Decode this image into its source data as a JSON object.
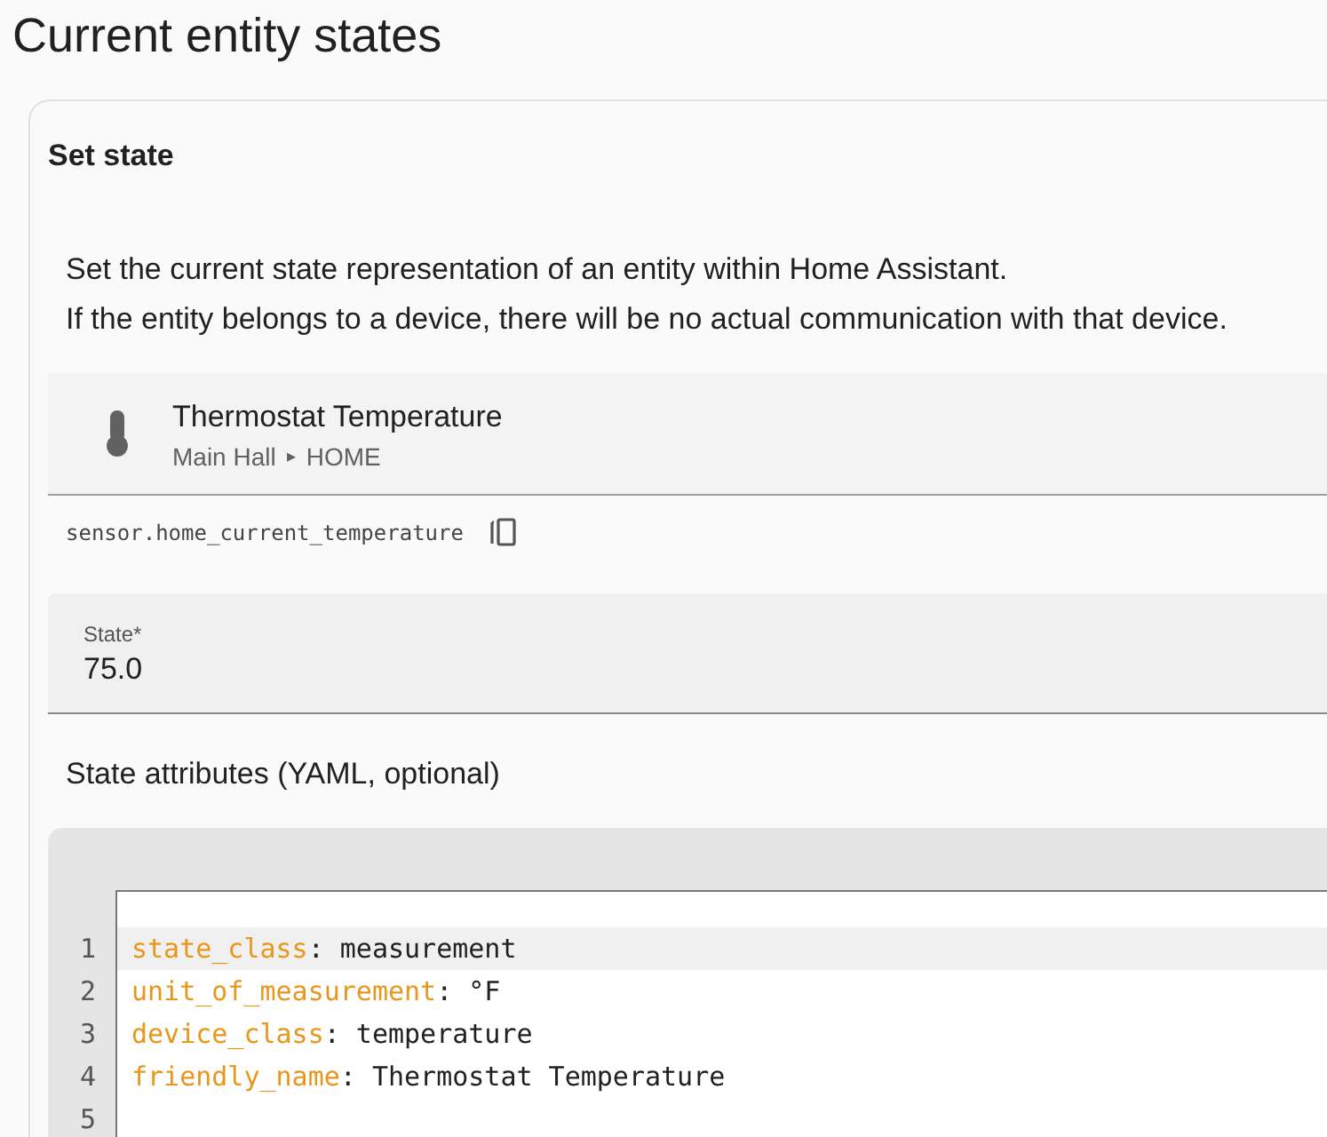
{
  "page_title": "Current entity states",
  "card": {
    "title": "Set state",
    "description": [
      "Set the current state representation of an entity within Home Assistant.",
      "If the entity belongs to a device, there will be no actual communication with that device."
    ],
    "entity": {
      "name": "Thermostat Temperature",
      "area": "Main Hall",
      "separator": "▸",
      "device": "HOME",
      "entity_id": "sensor.home_current_temperature"
    },
    "state_field": {
      "label": "State*",
      "value": "75.0"
    },
    "attributes_label": "State attributes (YAML, optional)",
    "code_lines": [
      {
        "number": "1",
        "key": "state_class",
        "value": ": measurement",
        "selected": true
      },
      {
        "number": "2",
        "key": "unit_of_measurement",
        "value": ": °F",
        "selected": false
      },
      {
        "number": "3",
        "key": "device_class",
        "value": ": temperature",
        "selected": false
      },
      {
        "number": "4",
        "key": "friendly_name",
        "value": ": Thermostat Temperature",
        "selected": false
      },
      {
        "number": "5",
        "selected": false
      }
    ]
  }
}
